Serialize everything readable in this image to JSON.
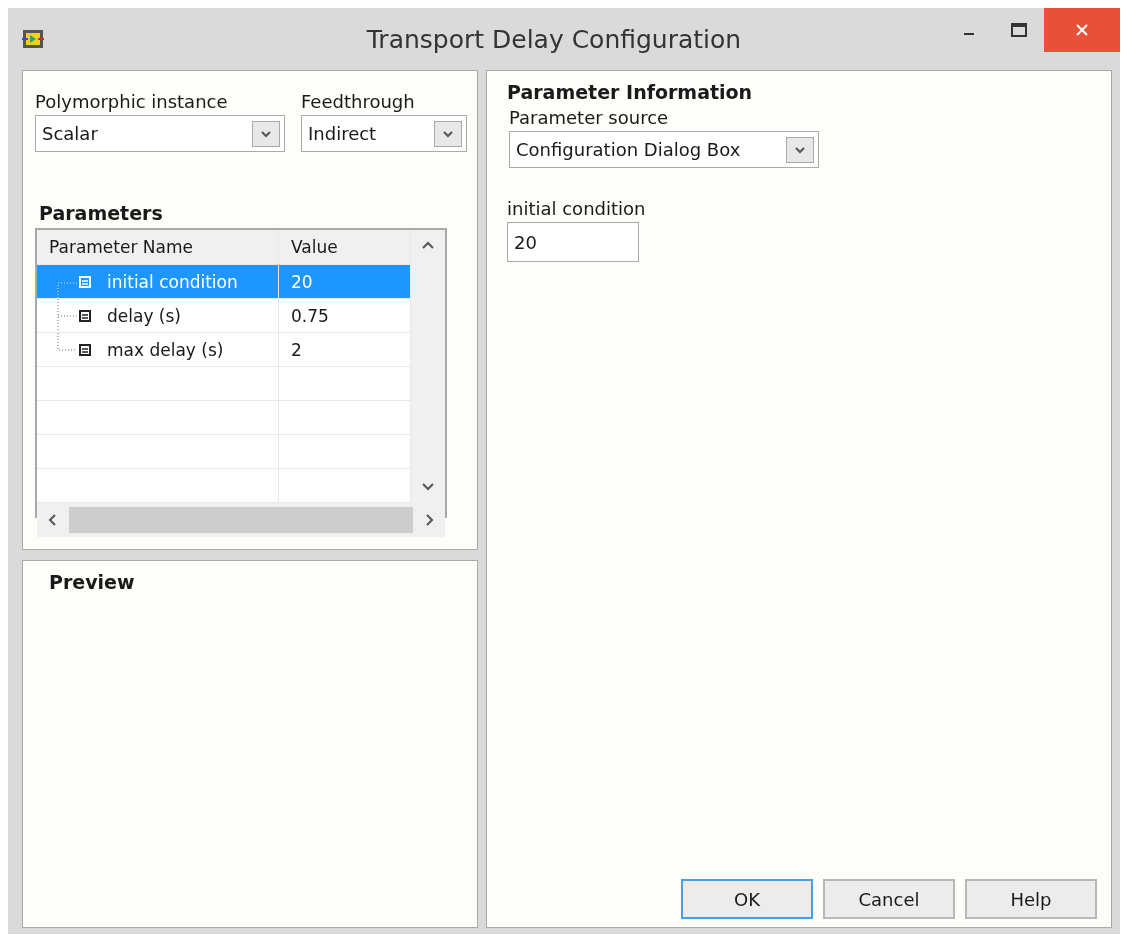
{
  "window": {
    "title": "Transport Delay Configuration"
  },
  "polymorphic_instance": {
    "label": "Polymorphic instance",
    "value": "Scalar"
  },
  "feedthrough": {
    "label": "Feedthrough",
    "value": "Indirect"
  },
  "parameters": {
    "title": "Parameters",
    "columns": [
      "Parameter Name",
      "Value"
    ],
    "rows": [
      {
        "name": "initial condition",
        "value": "20",
        "selected": true
      },
      {
        "name": "delay (s)",
        "value": "0.75",
        "selected": false
      },
      {
        "name": "max delay (s)",
        "value": "2",
        "selected": false
      }
    ]
  },
  "preview": {
    "title": "Preview"
  },
  "parameter_information": {
    "title": "Parameter Information",
    "source_label": "Parameter source",
    "source_value": "Configuration Dialog Box",
    "field_label": "initial condition",
    "field_value": "20"
  },
  "buttons": [
    {
      "label": "OK",
      "default": true
    },
    {
      "label": "Cancel",
      "default": false
    },
    {
      "label": "Help",
      "default": false
    }
  ]
}
